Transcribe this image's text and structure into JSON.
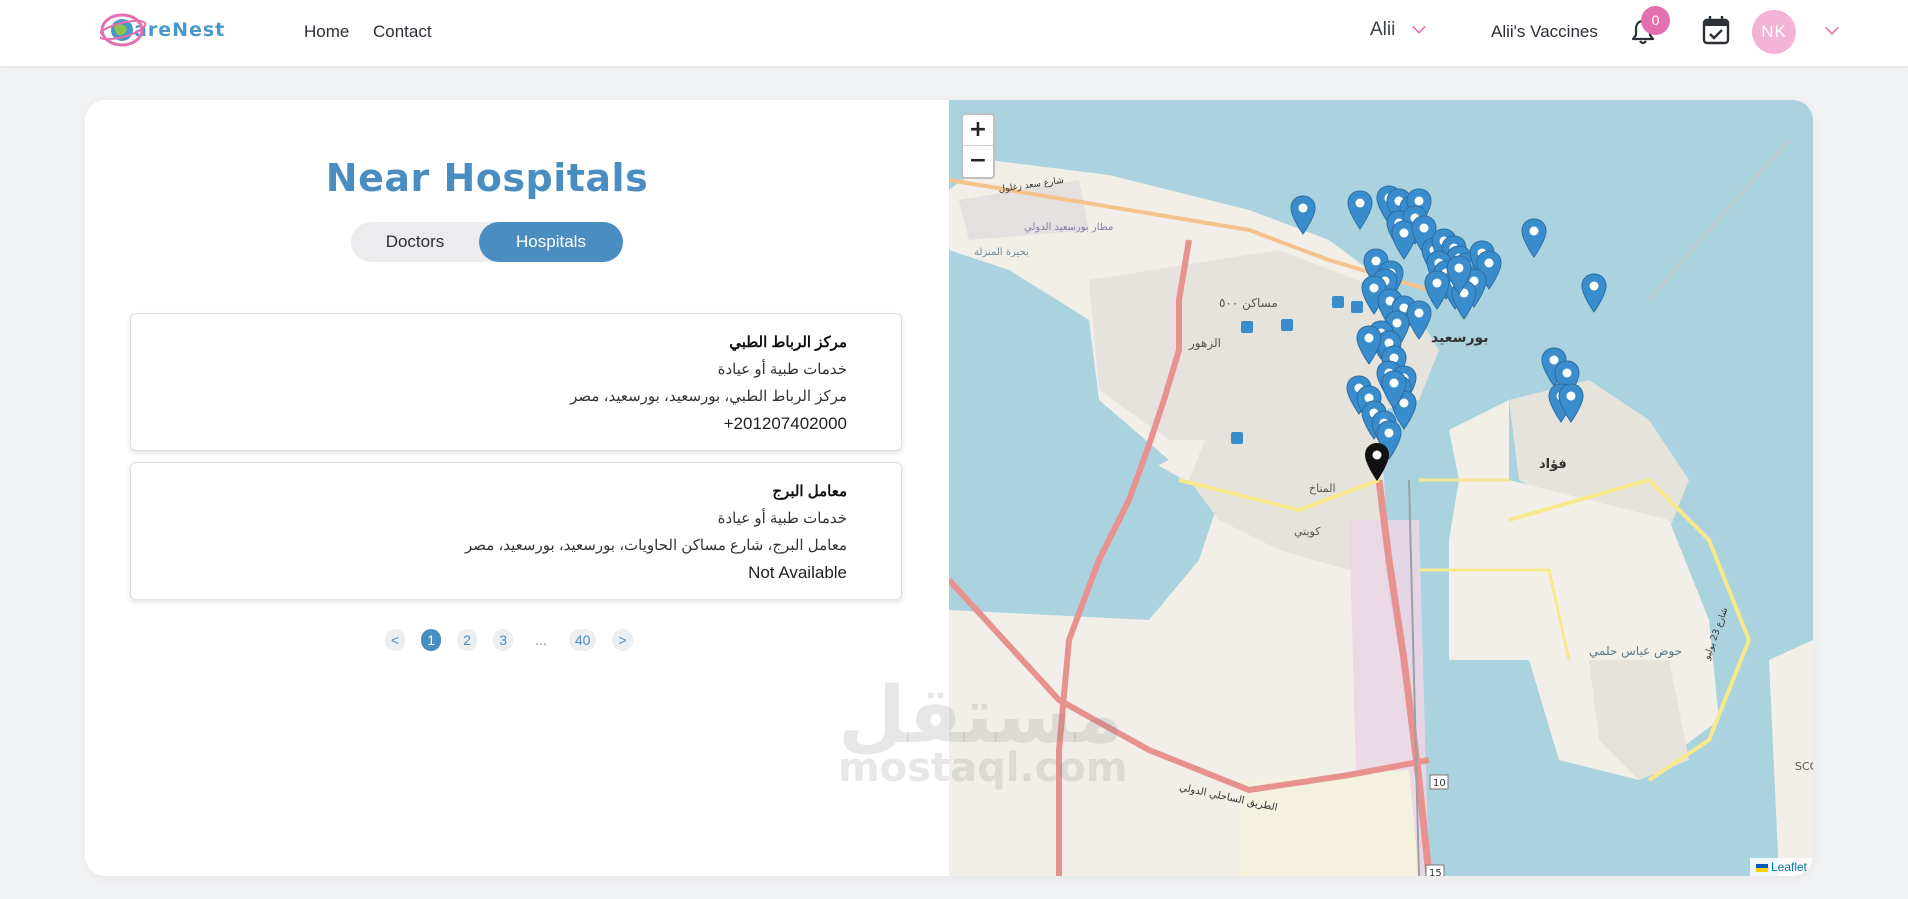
{
  "navbar": {
    "logo_text": "areNest",
    "links": [
      {
        "label": "Home"
      },
      {
        "label": "Contact"
      }
    ],
    "user_name": "Alii",
    "vaccines_link": "Alii's Vaccines",
    "notification_count": "0",
    "avatar_initials": "NK"
  },
  "page": {
    "title": "Near Hospitals",
    "toggle": {
      "doctors": "Doctors",
      "hospitals": "Hospitals",
      "selected": "Hospitals"
    }
  },
  "results": [
    {
      "name": "مركز الرباط الطبي",
      "category": "خدمات طبية أو عيادة",
      "address": "مركز الرباط الطبي، بورسعيد، بورسعيد، مصر",
      "phone": "+201207402000"
    },
    {
      "name": "معامل البرج",
      "category": "خدمات طبية أو عيادة",
      "address": "معامل البرج، شارع مساكن الحاويات، بورسعيد، بورسعيد، مصر",
      "phone": "Not Available"
    }
  ],
  "pagination": {
    "prev": "<",
    "pages": [
      "1",
      "2",
      "3",
      "...",
      "40"
    ],
    "current": "1",
    "next": ">"
  },
  "map": {
    "zoom_in": "+",
    "zoom_out": "−",
    "attribution": "Leaflet",
    "labels": {
      "port_said": "بورسعيد",
      "fouad": "فؤاد",
      "zohour": "الزهور",
      "masaken": "مساكن ٥٠٠",
      "airport": "مطار بورسعيد الدولي",
      "lake": "بحيرة المنزلة",
      "dock": "حوض عباس حلمي",
      "kuwaiti": "كويتي",
      "manakh": "المناخ",
      "coastal_road": "الطريق الساحلي الدولي",
      "saad_zaghloul": "شارع سعد زغلول",
      "road_23_july": "شارع 23 يوليو",
      "route_10": "10",
      "route_15": "15",
      "sco": "SCO"
    },
    "marker_color": "#3a8dcd",
    "user_marker_color": "#111111"
  },
  "watermark": {
    "arabic": "مستقل",
    "latin": "mostaql.com"
  }
}
